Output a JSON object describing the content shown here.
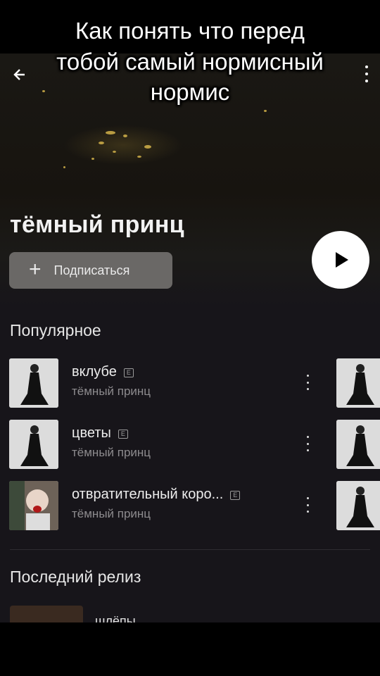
{
  "caption": {
    "lines": [
      "Как понять что перед",
      "тобой самый нормисный",
      "нормис"
    ]
  },
  "header": {
    "back_icon": "arrow-left-icon",
    "menu_icon": "more-vertical-icon"
  },
  "artist": {
    "name": "тёмный принц",
    "subscribe_label": "Подписаться",
    "play_icon": "play-icon"
  },
  "popular": {
    "title": "Популярное",
    "tracks": [
      {
        "title": "вклубе",
        "artist": "тёмный принц",
        "explicit": "E"
      },
      {
        "title": "цветы",
        "artist": "тёмный принц",
        "explicit": "E"
      },
      {
        "title": "отвратительный коро...",
        "artist": "тёмный принц",
        "explicit": "E"
      }
    ]
  },
  "latest": {
    "title": "Последний релиз",
    "release_title": "шлёпы"
  },
  "colors": {
    "background": "#17151a",
    "button": "#6a6866",
    "accent": "#ffffff"
  }
}
